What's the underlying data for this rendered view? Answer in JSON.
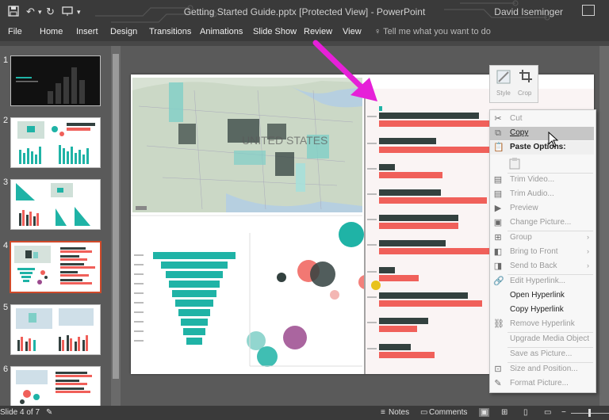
{
  "window": {
    "title": "Getting Started Guide.pptx [Protected View] - PowerPoint",
    "user": "David Iseminger"
  },
  "menu": [
    "File",
    "Home",
    "Insert",
    "Design",
    "Transitions",
    "Animations",
    "Slide Show",
    "Review",
    "View"
  ],
  "tell_me": "Tell me what you want to do",
  "slides": [
    {
      "num": "1"
    },
    {
      "num": "2"
    },
    {
      "num": "3"
    },
    {
      "num": "4"
    },
    {
      "num": "5"
    },
    {
      "num": "6"
    }
  ],
  "selected_slide": 4,
  "mini_toolbar": {
    "style": "Style",
    "crop": "Crop"
  },
  "context_menu": {
    "cut": "Cut",
    "copy": "Copy",
    "paste_options": "Paste Options:",
    "trim_video": "Trim Video...",
    "trim_audio": "Trim Audio...",
    "preview": "Preview",
    "change_picture": "Change Picture...",
    "group": "Group",
    "bring_to_front": "Bring to Front",
    "send_to_back": "Send to Back",
    "edit_hyperlink": "Edit Hyperlink...",
    "open_hyperlink": "Open Hyperlink",
    "copy_hyperlink": "Copy Hyperlink",
    "remove_hyperlink": "Remove Hyperlink",
    "upgrade_media": "Upgrade Media Object",
    "save_as_picture": "Save as Picture...",
    "size_position": "Size and Position...",
    "format_picture": "Format Picture..."
  },
  "map_label": "UNITED STATES",
  "status": {
    "slide_of": "Slide 4 of 7",
    "notes": "Notes",
    "comments": "Comments"
  },
  "colors": {
    "teal": "#1fb3a6",
    "dark": "#33413f",
    "coral": "#f0605a",
    "arrow": "#e620d8"
  }
}
